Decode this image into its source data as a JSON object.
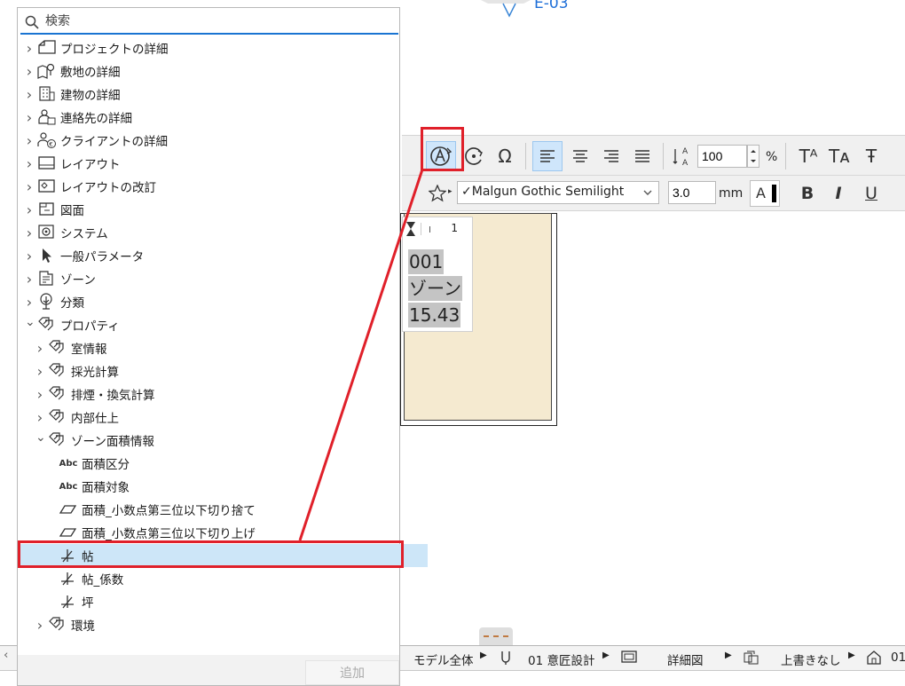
{
  "canvas": {
    "marker_label": "E-03",
    "ruler_value": "1",
    "zone_text_lines": [
      "001",
      "ゾーン",
      "15.43"
    ]
  },
  "toolbar": {
    "size_value": "100",
    "size_unit": "%",
    "font_name": "Malgun Gothic Semilight",
    "font_size_value": "3.0",
    "font_size_unit": "mm",
    "color_letter": "A",
    "bold_label": "B",
    "italic_label": "I",
    "underline_label": "U",
    "superscript_label": "Tᴬ",
    "subscript_label": "Tᴀ",
    "strike_label": "Ŧ"
  },
  "panel": {
    "search_placeholder": "検索",
    "items": [
      {
        "label": "プロジェクトの詳細",
        "icon": "house-outline-icon"
      },
      {
        "label": "敷地の詳細",
        "icon": "map-pin-icon"
      },
      {
        "label": "建物の詳細",
        "icon": "building-icon"
      },
      {
        "label": "連絡先の詳細",
        "icon": "contact-person-icon"
      },
      {
        "label": "クライアントの詳細",
        "icon": "client-euro-icon"
      },
      {
        "label": "レイアウト",
        "icon": "layout-sheet-icon"
      },
      {
        "label": "レイアウトの改訂",
        "icon": "layout-revision-icon"
      },
      {
        "label": "図面",
        "icon": "drawing-icon"
      },
      {
        "label": "システム",
        "icon": "system-gear-icon"
      },
      {
        "label": "一般パラメータ",
        "icon": "cursor-arrow-icon"
      },
      {
        "label": "ゾーン",
        "icon": "zone-stamp-icon"
      },
      {
        "label": "分類",
        "icon": "tree-icon"
      },
      {
        "label": "プロパティ",
        "icon": "tags-icon"
      },
      {
        "label": "室情報",
        "icon": "tags-icon"
      },
      {
        "label": "採光計算",
        "icon": "tags-icon"
      },
      {
        "label": "排煙・換気計算",
        "icon": "tags-icon"
      },
      {
        "label": "内部仕上",
        "icon": "tags-icon"
      },
      {
        "label": "ゾーン面積情報",
        "icon": "tags-icon"
      },
      {
        "label": "面積区分",
        "icon": "abc-icon"
      },
      {
        "label": "面積対象",
        "icon": "abc-icon"
      },
      {
        "label": "面積_小数点第三位以下切り捨て",
        "icon": "area-parallelogram-icon"
      },
      {
        "label": "面積_小数点第三位以下切り上げ",
        "icon": "area-parallelogram-icon"
      },
      {
        "label": "帖",
        "icon": "number-icon"
      },
      {
        "label": "帖_係数",
        "icon": "number-icon"
      },
      {
        "label": "坪",
        "icon": "number-icon"
      },
      {
        "label": "環境",
        "icon": "tags-icon"
      }
    ],
    "abc_text": "Abc",
    "add_button": "追加"
  },
  "statusbar": {
    "model_scope": "モデル全体",
    "design_layer": "01 意匠設計",
    "detail_level": "詳細図",
    "override": "上書きなし",
    "last_item": "01"
  },
  "colors": {
    "highlight_red": "#e0202a",
    "selection_blue": "#cde6f8",
    "accent_blue": "#1a74d2",
    "zone_fill": "#f5ead0"
  }
}
